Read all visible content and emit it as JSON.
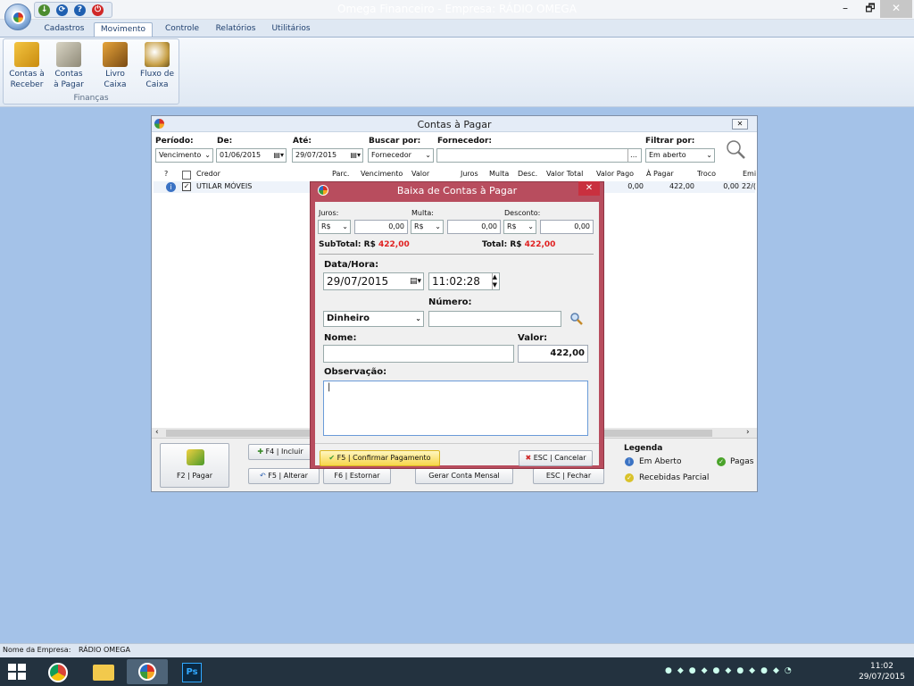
{
  "app": {
    "title": "Omega Financeiro - Empresa: RÁDIO OMEGA"
  },
  "window_controls": {
    "minimize": "–",
    "restore": "🗗",
    "close": "✕"
  },
  "menu": {
    "tabs": [
      {
        "label": "Cadastros"
      },
      {
        "label": "Movimento"
      },
      {
        "label": "Controle"
      },
      {
        "label": "Relatórios"
      },
      {
        "label": "Utilitários"
      }
    ]
  },
  "ribbon": {
    "group": "Finanças",
    "buttons": [
      {
        "line1": "Contas à",
        "line2": "Receber"
      },
      {
        "line1": "Contas",
        "line2": "à Pagar"
      },
      {
        "line1": "Livro",
        "line2": "Caixa"
      },
      {
        "line1": "Fluxo de",
        "line2": "Caixa"
      }
    ]
  },
  "contas": {
    "title": "Contas à Pagar",
    "filters": {
      "periodo_label": "Período:",
      "periodo_value": "Vencimento",
      "de_label": "De:",
      "de_value": "01/06/2015",
      "ate_label": "Até:",
      "ate_value": "29/07/2015",
      "buscar_label": "Buscar por:",
      "buscar_value": "Fornecedor",
      "fornecedor_label": "Fornecedor:",
      "fornecedor_value": "",
      "filtrar_label": "Filtrar por:",
      "filtrar_value": "Em aberto"
    },
    "columns": [
      "?",
      "Credor",
      "Parc.",
      "Vencimento",
      "Valor",
      "Juros",
      "Multa",
      "Desc.",
      "Valor Total",
      "Valor Pago",
      "À Pagar",
      "Troco",
      "Emi"
    ],
    "row": {
      "credor": "UTILAR MÓVEIS",
      "valor_pago": "0,00",
      "a_pagar": "422,00",
      "troco": "0,00",
      "emi": "22/("
    },
    "buttons": {
      "pagar": "F2 | Pagar",
      "incluir": "F4 | Incluir",
      "alterar": "F5 | Alterar",
      "estornar": "F6 | Estornar",
      "gerar": "Gerar Conta Mensal",
      "fechar": "ESC | Fechar"
    },
    "legend": {
      "title": "Legenda",
      "em_aberto": "Em Aberto",
      "pagas": "Pagas",
      "recebidas": "Recebidas Parcial"
    }
  },
  "baixa": {
    "title": "Baixa de Contas à Pagar",
    "juros_label": "Juros:",
    "juros_currency": "R$",
    "juros_value": "0,00",
    "multa_label": "Multa:",
    "multa_currency": "R$",
    "multa_value": "0,00",
    "desconto_label": "Desconto:",
    "desconto_currency": "R$",
    "desconto_value": "0,00",
    "subtotal_label": "SubTotal:",
    "subtotal_currency": "R$",
    "subtotal_value": "422,00",
    "total_label": "Total:",
    "total_currency": "R$",
    "total_value": "422,00",
    "datahora_label": "Data/Hora:",
    "data_value": "29/07/2015",
    "hora_value": "11:02:28",
    "numero_label": "Número:",
    "forma_value": "Dinheiro",
    "numero_value": "",
    "nome_label": "Nome:",
    "nome_value": "",
    "valor_label": "Valor:",
    "valor_value": "422,00",
    "obs_label": "Observação:",
    "obs_value": "|",
    "confirm_button": "F5 | Confirmar Pagamento",
    "cancel_button": "ESC | Cancelar"
  },
  "status": {
    "company_label": "Nome da Empresa:",
    "company_value": "RÁDIO OMEGA"
  },
  "taskbar": {
    "time": "11:02",
    "date": "29/07/2015"
  },
  "colors": {
    "modal_frame": "#b84d5e",
    "accent_red": "#e02020",
    "ribbon_bg": "#dfe8f3"
  }
}
